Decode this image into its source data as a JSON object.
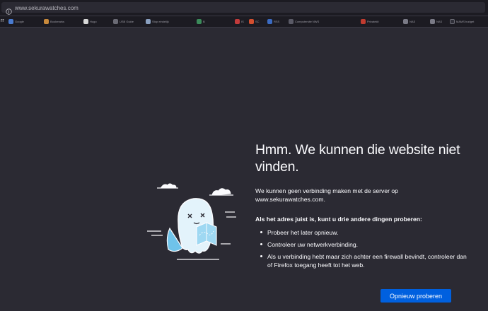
{
  "address_bar": {
    "url": "www.sekurawatches.com",
    "icon": "info-icon"
  },
  "bookmarks": {
    "lead_glyph": "rr",
    "items": [
      {
        "label": "Google",
        "color": "#4a7bd0"
      },
      {
        "label": "Bookmarks",
        "color": "#c98a3c"
      },
      {
        "label": "Hugo",
        "color": "#d8d8d8"
      },
      {
        "label": "USB Guide",
        "color": "#6a6a74"
      },
      {
        "label": "Stop eindelijk",
        "color": "#8aa0c0"
      },
      {
        "label": "B",
        "color": "#3b8b5a"
      },
      {
        "label": "IS",
        "color": "#c23b3b"
      },
      {
        "label": "SC",
        "color": "#d34f2f"
      },
      {
        "label": "RSS",
        "color": "#3b6bc2"
      },
      {
        "label": "Computersite NWS",
        "color": "#5a5a66"
      },
      {
        "label": "Privatekit",
        "color": "#c03b2f"
      },
      {
        "label": "NAS",
        "color": "#7a7a86"
      },
      {
        "label": "NAS",
        "color": "#7a7a86"
      },
      {
        "label": "MAMS budget",
        "color": "#2f2f38"
      }
    ]
  },
  "error_page": {
    "title": "Hmm. We kunnen die website niet vinden.",
    "message": "We kunnen geen verbinding maken met de server op www.sekurawatches.com.",
    "suggestions_title": "Als het adres juist is, kunt u drie andere dingen proberen:",
    "suggestions": [
      "Probeer het later opnieuw.",
      "Controleer uw netwerkverbinding.",
      "Als u verbinding hebt maar zich achter een firewall bevindt, controleer dan of Firefox toegang heeft tot het web."
    ],
    "retry_label": "Opnieuw proberen",
    "retry_color": "#0060df"
  }
}
